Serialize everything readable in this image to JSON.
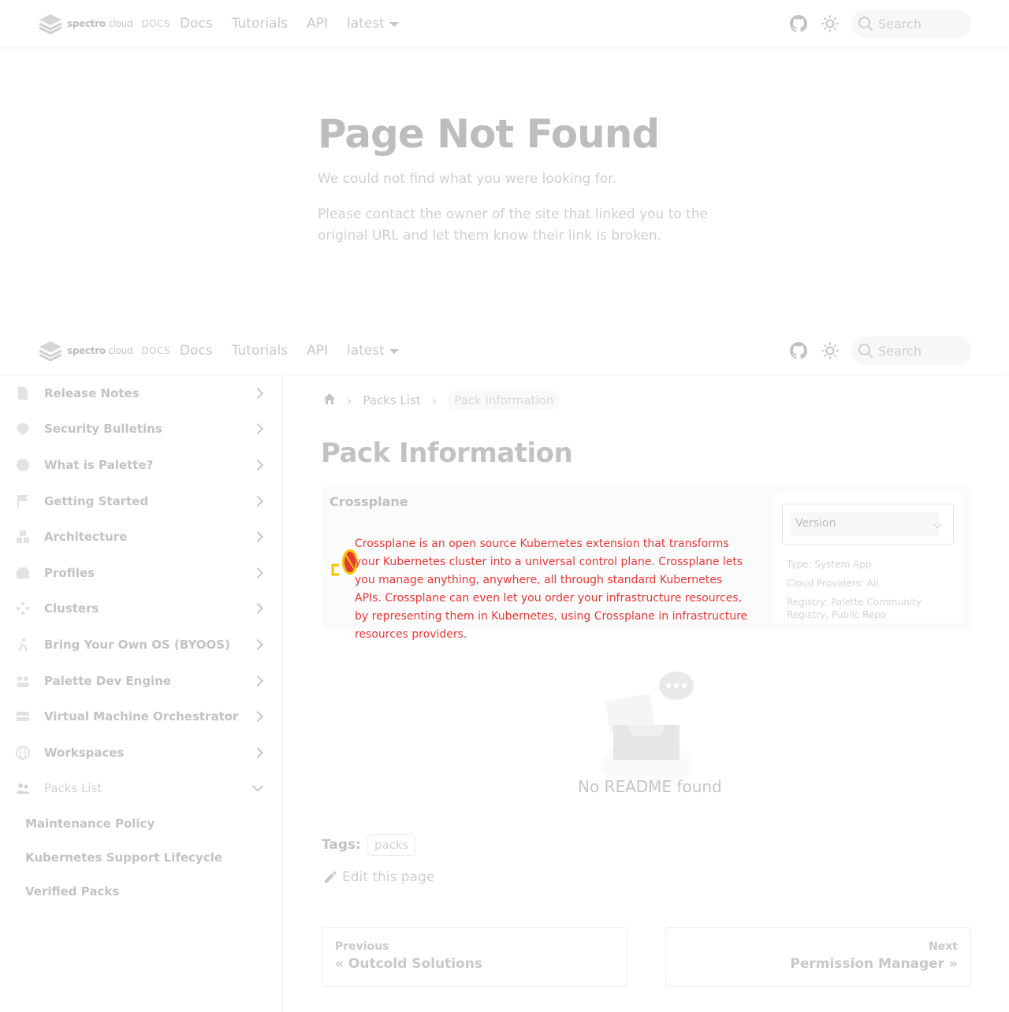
{
  "navbar": {
    "brand_primary": "spectro",
    "brand_secondary": "cloud",
    "brand_docs": "DOCS",
    "links": [
      "Docs",
      "Tutorials",
      "API"
    ],
    "version_label": "latest",
    "search_placeholder": "Search"
  },
  "not_found": {
    "title": "Page Not Found",
    "line1": "We could not find what you were looking for.",
    "line2": "Please contact the owner of the site that linked you to the original URL and let them know their link is broken."
  },
  "sidebar": {
    "items": [
      {
        "label": "Release Notes",
        "icon": "file-icon"
      },
      {
        "label": "Security Bulletins",
        "icon": "shield-icon"
      },
      {
        "label": "What is Palette?",
        "icon": "palette-icon"
      },
      {
        "label": "Getting Started",
        "icon": "flag-icon"
      },
      {
        "label": "Architecture",
        "icon": "cubes-icon"
      },
      {
        "label": "Profiles",
        "icon": "layers-icon"
      },
      {
        "label": "Clusters",
        "icon": "nodes-icon"
      },
      {
        "label": "Bring Your Own OS (BYOOS)",
        "icon": "person-icon"
      },
      {
        "label": "Palette Dev Engine",
        "icon": "users-icon"
      },
      {
        "label": "Virtual Machine Orchestrator",
        "icon": "server-icon"
      },
      {
        "label": "Workspaces",
        "icon": "globe-icon"
      },
      {
        "label": "Packs List",
        "icon": "group-icon"
      }
    ],
    "sub_items": [
      "Maintenance Policy",
      "Kubernetes Support Lifecycle",
      "Verified Packs"
    ]
  },
  "breadcrumb": {
    "items": [
      "Packs List"
    ],
    "current": "Pack Information"
  },
  "page": {
    "title": "Pack Information"
  },
  "pack": {
    "name": "Crossplane",
    "description": "Crossplane is an open source Kubernetes extension that transforms your Kubernetes cluster into a universal control plane. Crossplane lets you manage anything, anywhere, all through standard Kubernetes APIs. Crossplane can even let you order your infrastructure resources, by representing them in Kubernetes, using Crossplane in infrastructure resources providers.",
    "version_label": "Version",
    "type": "Type: System App",
    "cloud_providers": "Cloud Providers: All",
    "registry": "Registry: Palette Community Registry, Public Repo"
  },
  "readme": {
    "label": "No README found"
  },
  "tags": {
    "label": "Tags:",
    "values": [
      "packs"
    ]
  },
  "edit": {
    "label": "Edit this page"
  },
  "pager": {
    "prev_sub": "Previous",
    "prev_label": "« Outcold Solutions",
    "next_sub": "Next",
    "next_label": "Permission Manager »"
  }
}
